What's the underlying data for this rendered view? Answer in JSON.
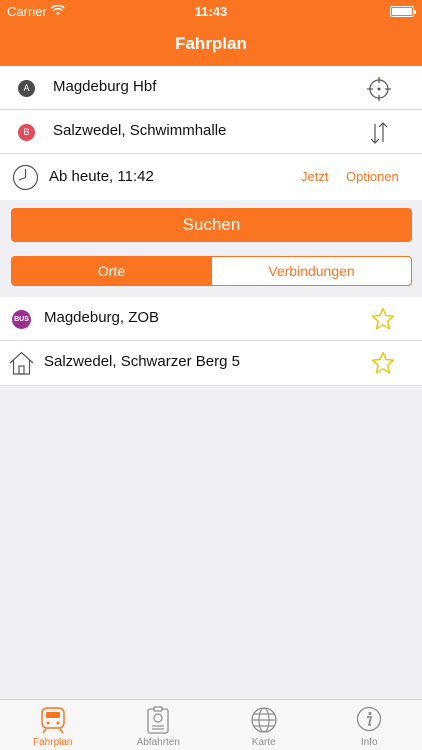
{
  "status_bar": {
    "carrier": "Carrier",
    "time": "11:43"
  },
  "nav": {
    "title": "Fahrplan"
  },
  "from": {
    "badge": "A",
    "value": "Magdeburg Hbf",
    "action_icon": "locate-crosshair-icon"
  },
  "to": {
    "badge": "B",
    "value": "Salzwedel, Schwimmhalle",
    "action_icon": "swap-arrows-icon"
  },
  "datetime": {
    "value": "Ab heute, 11:42",
    "now_label": "Jetzt",
    "options_label": "Optionen"
  },
  "search_button": "Suchen",
  "segment": {
    "tabs": [
      "Orte",
      "Verbindungen"
    ],
    "selected": "Orte"
  },
  "favorites": [
    {
      "icon": "bus-stop-icon",
      "icon_text": "BUS",
      "label": "Magdeburg, ZOB"
    },
    {
      "icon": "home-icon",
      "label": "Salzwedel, Schwarzer Berg 5"
    }
  ],
  "tabbar": {
    "items": [
      "Fahrplan",
      "Abfahrten",
      "Karte",
      "Info"
    ],
    "selected": "Fahrplan"
  },
  "colors": {
    "accent": "#fb7421",
    "star": "#f2c200",
    "bus": "#9b2f8f",
    "badge_b": "#e44b5a"
  }
}
